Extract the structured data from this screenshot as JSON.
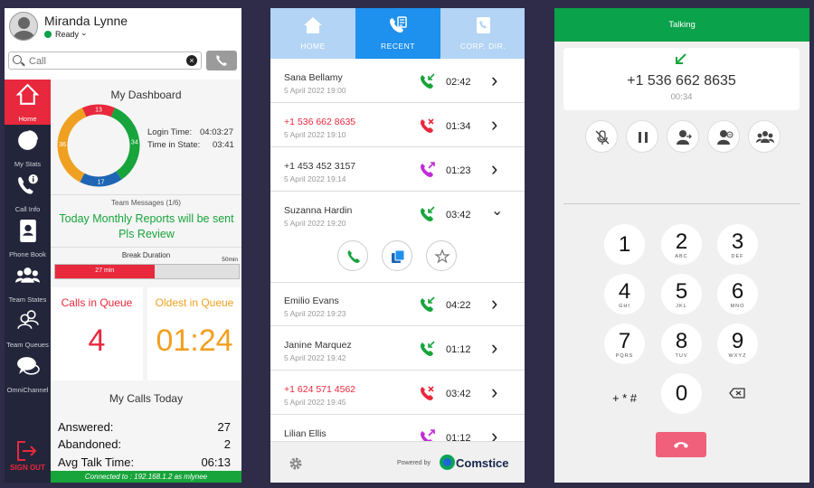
{
  "agent_panel": {
    "agent_name": "Miranda Lynne",
    "status": "Ready",
    "search_placeholder": "Call",
    "sidebar": [
      {
        "label": "Home",
        "icon": "home-icon",
        "active": true
      },
      {
        "label": "My Stats",
        "icon": "pie-chart-icon",
        "active": false
      },
      {
        "label": "Call Info",
        "icon": "call-info-icon",
        "active": false
      },
      {
        "label": "Phone Book",
        "icon": "phone-book-icon",
        "active": false
      },
      {
        "label": "Team States",
        "icon": "team-icon",
        "active": false
      },
      {
        "label": "Team Queues",
        "icon": "team-queues-icon",
        "active": false
      },
      {
        "label": "OmniChannel",
        "icon": "chat-bubbles-icon",
        "active": false
      }
    ],
    "sign_out_label": "SIGN OUT",
    "dashboard": {
      "title": "My Dashboard",
      "donut": {
        "segments": [
          {
            "value": 13,
            "color": "#e8283c"
          },
          {
            "value": 34,
            "color": "#17a43b"
          },
          {
            "value": 17,
            "color": "#1e66b4"
          },
          {
            "value": 36,
            "color": "#f0a020"
          }
        ]
      },
      "login_time_label": "Login Time:",
      "login_time": "04:03:27",
      "time_in_state_label": "Time in State:",
      "time_in_state": "03:41",
      "team_messages_label": "Team Messages (1/6)",
      "team_message": "Today Monthly Reports will be sent Pls Review",
      "break_label": "Break Duration",
      "break_max": "50min",
      "break_value": "27 min",
      "break_fraction": 0.54,
      "calls_in_queue_label": "Calls in Queue",
      "calls_in_queue": "4",
      "oldest_in_queue_label": "Oldest in Queue",
      "oldest_in_queue": "01:24",
      "my_calls_title": "My Calls Today",
      "answered_label": "Answered:",
      "answered": "27",
      "abandoned_label": "Abandoned:",
      "abandoned": "2",
      "avg_talk_label": "Avg Talk Time:",
      "avg_talk": "06:13"
    },
    "connection": "Connected to : 192.168.1.2 as mlynee"
  },
  "recent_panel": {
    "tabs": [
      {
        "label": "HOME",
        "icon": "home-icon",
        "active": false
      },
      {
        "label": "RECENT",
        "icon": "recent-calls-icon",
        "active": true
      },
      {
        "label": "CORP. DIR.",
        "icon": "directory-icon",
        "active": false
      }
    ],
    "calls": [
      {
        "name": "Sana Bellamy",
        "date": "5 April 2022 19:00",
        "type": "incoming",
        "duration": "02:42",
        "missed": false
      },
      {
        "name": "+1 536 662 8635",
        "date": "5 April 2022 19:10",
        "type": "missed",
        "duration": "01:34",
        "missed": true
      },
      {
        "name": "+1 453 452 3157",
        "date": "5 April 2022 19:14",
        "type": "outgoing",
        "duration": "01:23",
        "missed": false
      },
      {
        "name": "Suzanna Hardin",
        "date": "5 April 2022 19:20",
        "type": "incoming",
        "duration": "03:42",
        "missed": false
      },
      {
        "name": "Emilio Evans",
        "date": "5 April 2022 19:23",
        "type": "incoming",
        "duration": "04:22",
        "missed": false
      },
      {
        "name": "Janine Marquez",
        "date": "5 April 2022 19:42",
        "type": "incoming",
        "duration": "01:12",
        "missed": false
      },
      {
        "name": "+1 624 571 4562",
        "date": "5 April 2022 19:45",
        "type": "missed",
        "duration": "03:42",
        "missed": true
      },
      {
        "name": "Lilian Ellis",
        "date": "",
        "type": "outgoing",
        "duration": "01:12",
        "missed": false
      }
    ],
    "powered_by": "Powered by",
    "brand": "Comstice"
  },
  "call_panel": {
    "status": "Talking",
    "number": "+1 536 662 8635",
    "timer": "00:34",
    "controls": [
      "mute-icon",
      "hold-icon",
      "transfer-icon",
      "conference-icon",
      "group-icon"
    ],
    "keys": [
      {
        "digit": "1",
        "letters": ""
      },
      {
        "digit": "2",
        "letters": "ABC"
      },
      {
        "digit": "3",
        "letters": "DEF"
      },
      {
        "digit": "4",
        "letters": "GHI"
      },
      {
        "digit": "5",
        "letters": "JKL"
      },
      {
        "digit": "6",
        "letters": "MNO"
      },
      {
        "digit": "7",
        "letters": "PQRS"
      },
      {
        "digit": "8",
        "letters": "TUV"
      },
      {
        "digit": "9",
        "letters": "WXYZ"
      }
    ],
    "symbols_key": "+ * #",
    "zero_key": "0"
  }
}
